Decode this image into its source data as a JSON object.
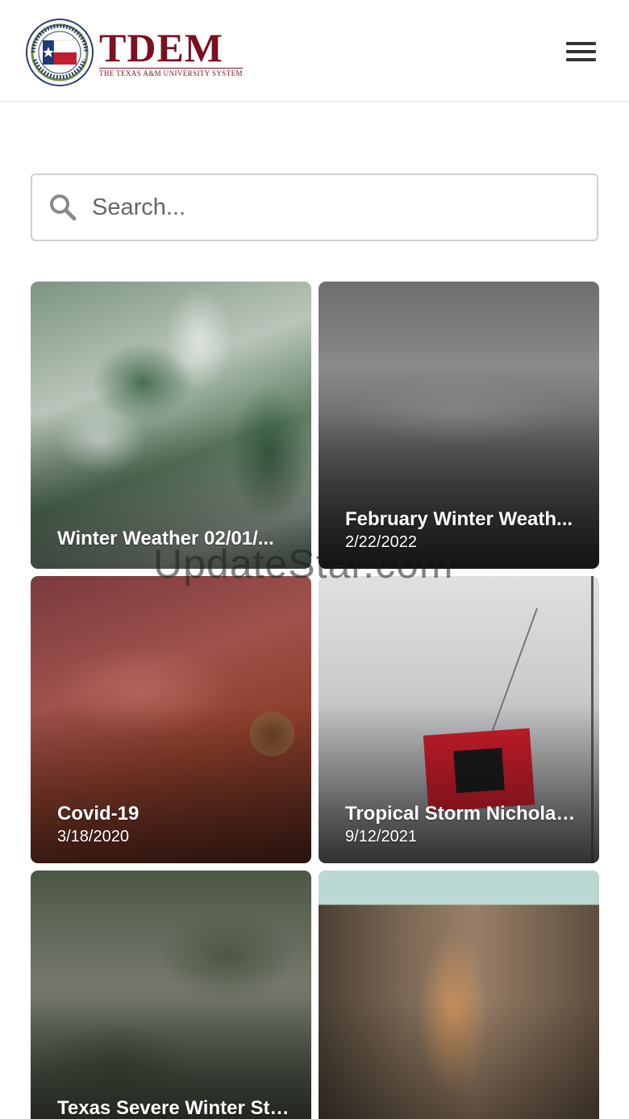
{
  "header": {
    "logo_name": "TDEM",
    "logo_subtitle": "THE TEXAS A&M UNIVERSITY SYSTEM",
    "logo_seal_text": "TEXAS DIVISION OF EMERGENCY MANAGEMENT",
    "brand_color": "#7a1020"
  },
  "search": {
    "placeholder": "Search..."
  },
  "events": [
    {
      "title": "Winter Weather 02/01/...",
      "date": ""
    },
    {
      "title": "February Winter Weath...",
      "date": "2/22/2022"
    },
    {
      "title": "Covid-19",
      "date": "3/18/2020"
    },
    {
      "title": "Tropical Storm Nicholas...",
      "date": "9/12/2021"
    },
    {
      "title": "Texas Severe Winter Sto...",
      "date": ""
    },
    {
      "title": "",
      "date": ""
    }
  ],
  "watermark": "UpdateStar.com"
}
